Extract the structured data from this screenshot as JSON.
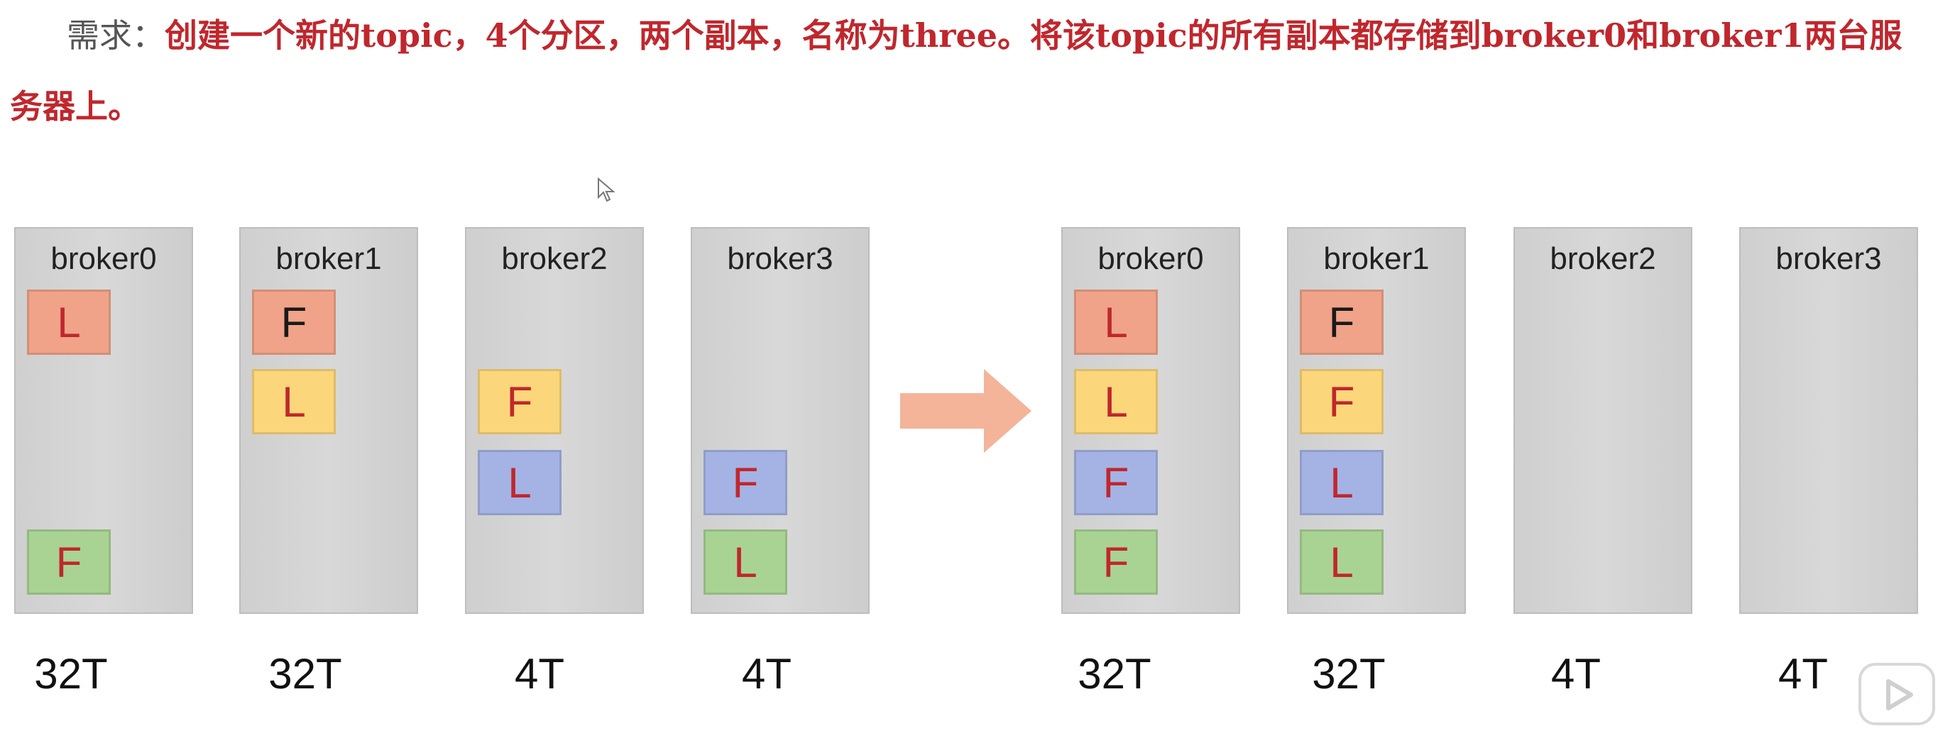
{
  "requirement": {
    "label": "需求：",
    "text": "创建一个新的topic，4个分区，两个副本，名称为three。将该topic的所有副本都存储到broker0和broker1两台服务器上。"
  },
  "icons": {
    "cursor": "cursor-pointer-icon",
    "arrow": "right-arrow-icon",
    "player": "video-play-icon"
  },
  "colors": {
    "text_red": "#c0272d",
    "leader_text": "#c0272d",
    "follower_text_red": "#c0272d",
    "follower_text_dark": "#1a1a1a",
    "partition_colors": {
      "p0": "#f0a388",
      "p1": "#fbd67a",
      "p2": "#a4b3e4",
      "p3": "#a9d393"
    }
  },
  "before": [
    {
      "name": "broker0",
      "capacity": "32T",
      "replicas": [
        {
          "role": "L",
          "partition": "p0",
          "slot": 0
        },
        {
          "role": "F",
          "partition": "p3",
          "slot": 3
        }
      ]
    },
    {
      "name": "broker1",
      "capacity": "32T",
      "replicas": [
        {
          "role": "F",
          "partition": "p0",
          "slot": 0
        },
        {
          "role": "L",
          "partition": "p1",
          "slot": 1
        }
      ]
    },
    {
      "name": "broker2",
      "capacity": "4T",
      "replicas": [
        {
          "role": "F",
          "partition": "p1",
          "slot": 1
        },
        {
          "role": "L",
          "partition": "p2",
          "slot": 2
        }
      ]
    },
    {
      "name": "broker3",
      "capacity": "4T",
      "replicas": [
        {
          "role": "F",
          "partition": "p2",
          "slot": 2
        },
        {
          "role": "L",
          "partition": "p3",
          "slot": 3
        }
      ]
    }
  ],
  "after": [
    {
      "name": "broker0",
      "capacity": "32T",
      "replicas": [
        {
          "role": "L",
          "partition": "p0",
          "slot": 0
        },
        {
          "role": "L",
          "partition": "p1",
          "slot": 1
        },
        {
          "role": "F",
          "partition": "p2",
          "slot": 2
        },
        {
          "role": "F",
          "partition": "p3",
          "slot": 3
        }
      ]
    },
    {
      "name": "broker1",
      "capacity": "32T",
      "replicas": [
        {
          "role": "F",
          "partition": "p0",
          "slot": 0
        },
        {
          "role": "F",
          "partition": "p1",
          "slot": 1
        },
        {
          "role": "L",
          "partition": "p2",
          "slot": 2
        },
        {
          "role": "L",
          "partition": "p3",
          "slot": 3
        }
      ]
    },
    {
      "name": "broker2",
      "capacity": "4T",
      "replicas": []
    },
    {
      "name": "broker3",
      "capacity": "4T",
      "replicas": []
    }
  ]
}
